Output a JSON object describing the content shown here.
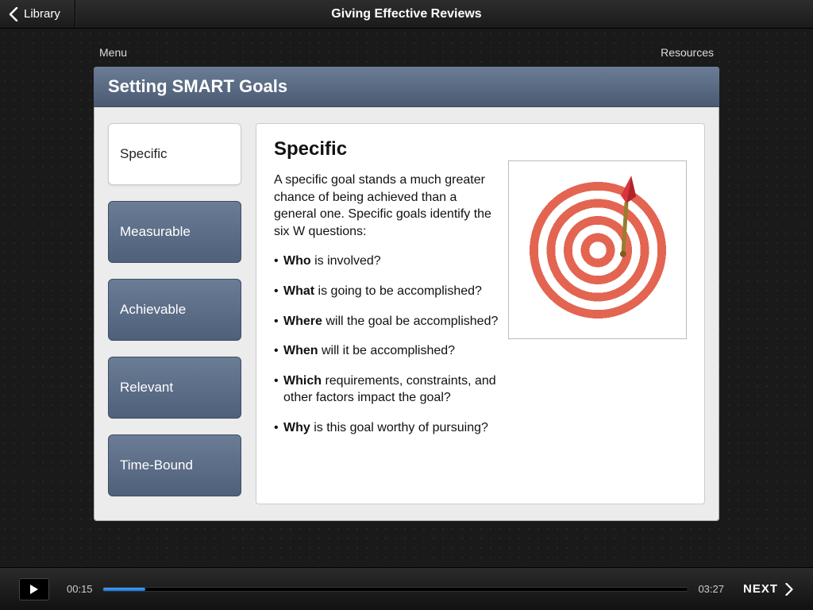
{
  "topbar": {
    "back_label": "Library",
    "title": "Giving Effective Reviews"
  },
  "submenu": {
    "menu_label": "Menu",
    "resources_label": "Resources"
  },
  "slide": {
    "header": "Setting SMART Goals",
    "tabs": [
      {
        "label": "Specific",
        "active": true
      },
      {
        "label": "Measurable",
        "active": false
      },
      {
        "label": "Achievable",
        "active": false
      },
      {
        "label": "Relevant",
        "active": false
      },
      {
        "label": "Time-Bound",
        "active": false
      }
    ],
    "content": {
      "heading": "Specific",
      "intro": "A specific goal stands a much greater chance of being achieved than a general one. Specific goals identify the six W questions:",
      "bullets": [
        {
          "bold": "Who",
          "rest": " is involved?"
        },
        {
          "bold": "What",
          "rest": " is going to be accomplished?"
        },
        {
          "bold": "Where",
          "rest": " will the goal be accomplished?"
        },
        {
          "bold": "When",
          "rest": " will it be accomplished?"
        },
        {
          "bold": "Which",
          "rest": " requirements, constraints, and other factors impact the goal?"
        },
        {
          "bold": "Why",
          "rest": " is this goal worthy of pursuing?"
        }
      ],
      "image_name": "dart-target"
    }
  },
  "player": {
    "current_time": "00:15",
    "total_time": "03:27",
    "progress_percent": 7.2,
    "next_label": "NEXT"
  }
}
